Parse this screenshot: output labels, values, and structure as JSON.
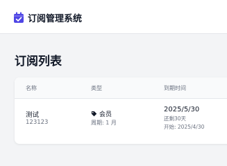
{
  "header": {
    "logo_icon": "calendar-check-icon",
    "app_title": "订阅管理系统",
    "accent_color": "#4f46e5"
  },
  "page": {
    "title": "订阅列表"
  },
  "table": {
    "columns": [
      "名称",
      "类型",
      "到期时间"
    ],
    "rows": [
      {
        "name": "测试",
        "account": "123123",
        "type_icon": "tag-icon",
        "type": "会员",
        "period": "周期: 1 月",
        "expiry_date": "2025/5/30",
        "remaining": "还剩30天",
        "start": "开始: 2025/4/30"
      }
    ]
  }
}
